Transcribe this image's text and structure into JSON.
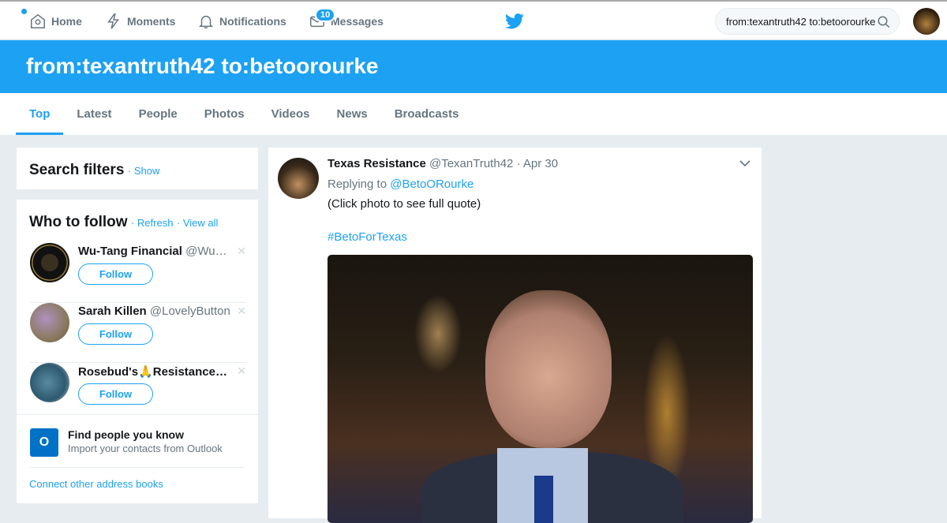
{
  "nav": {
    "home": "Home",
    "moments": "Moments",
    "notifications": "Notifications",
    "messages": "Messages",
    "messages_badge": "10"
  },
  "search": {
    "value": "from:texantruth42 to:betoorourke"
  },
  "banner": {
    "title": "from:texantruth42 to:betoorourke"
  },
  "tabs": [
    "Top",
    "Latest",
    "People",
    "Photos",
    "Videos",
    "News",
    "Broadcasts"
  ],
  "filters": {
    "title": "Search filters",
    "show": "Show"
  },
  "who_to_follow": {
    "title": "Who to follow",
    "refresh": "Refresh",
    "view_all": "View all",
    "follow_label": "Follow",
    "users": [
      {
        "name": "Wu-Tang Financial",
        "handle": "@Wu…"
      },
      {
        "name": "Sarah Killen",
        "handle": "@LovelyButton"
      },
      {
        "name": "Rosebud's🙏Resistance…",
        "handle": ""
      }
    ]
  },
  "find_people": {
    "title": "Find people you know",
    "subtitle": "Import your contacts from Outlook",
    "connect": "Connect other address books"
  },
  "tweet": {
    "name": "Texas Resistance",
    "handle": "@TexanTruth42",
    "date": "· Apr 30",
    "replying_prefix": "Replying to",
    "replying_to": "@BetoORourke",
    "text": "(Click photo to see full quote)",
    "hashtag": "#BetoForTexas"
  }
}
